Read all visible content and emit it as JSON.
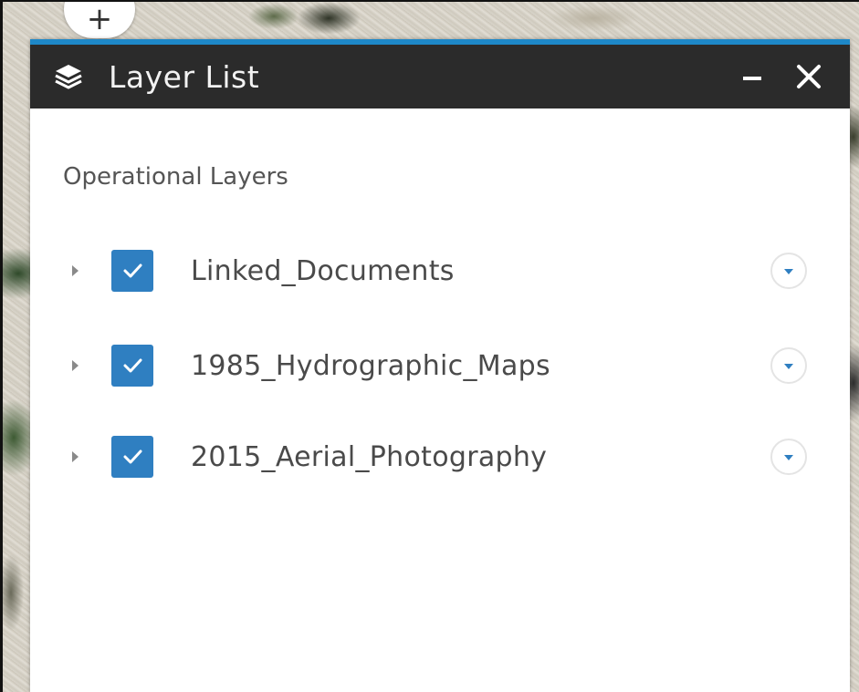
{
  "panel": {
    "title": "Layer List",
    "icon": "layers-icon",
    "minimize_icon": "minimize-icon",
    "close_icon": "close-icon",
    "accent_color": "#1e88c8",
    "header_color": "#2b2b2b"
  },
  "map": {
    "zoom_in_label": "+"
  },
  "section": {
    "label": "Operational Layers"
  },
  "layers": [
    {
      "name": "Linked_Documents",
      "checked": true
    },
    {
      "name": "1985_Hydrographic_Maps",
      "checked": true
    },
    {
      "name": "2015_Aerial_Photography",
      "checked": true
    }
  ],
  "colors": {
    "checkbox": "#2f7fc1",
    "text": "#4a4a4a"
  }
}
